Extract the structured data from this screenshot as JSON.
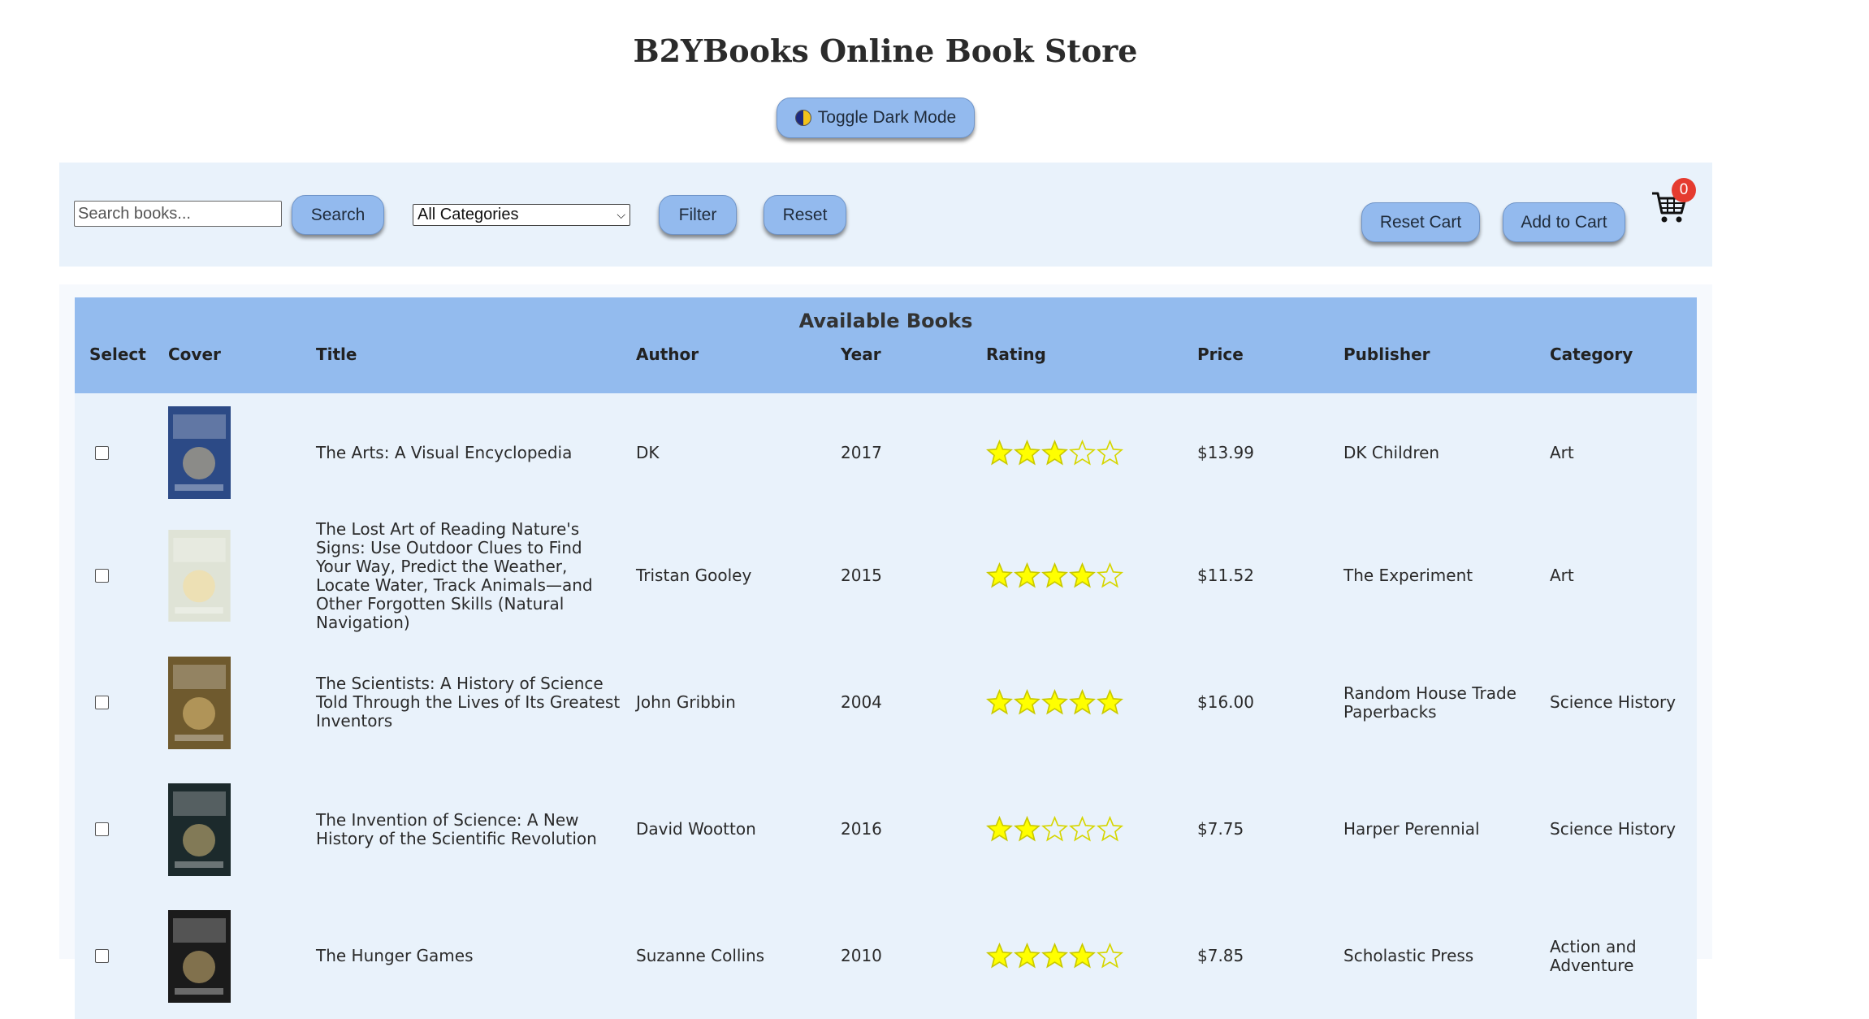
{
  "header": {
    "title": "B2YBooks Online Book Store",
    "toggle_label": "Toggle Dark Mode"
  },
  "toolbar": {
    "search_placeholder": "Search books...",
    "search_label": "Search",
    "category_selected": "All Categories",
    "filter_label": "Filter",
    "reset_label": "Reset",
    "reset_cart_label": "Reset Cart",
    "add_to_cart_label": "Add to Cart",
    "cart_count": "0"
  },
  "table": {
    "caption": "Available Books",
    "columns": [
      "Select",
      "Cover",
      "Title",
      "Author",
      "Year",
      "Rating",
      "Price",
      "Publisher",
      "Category"
    ],
    "rows": [
      {
        "title": "The Arts: A Visual Encyclopedia",
        "author": "DK",
        "year": "2017",
        "rating": 3,
        "price": "$13.99",
        "publisher": "DK Children",
        "category": "Art",
        "cover_color": "#2c4a86"
      },
      {
        "title": "The Lost Art of Reading Nature's Signs: Use Outdoor Clues to Find Your Way, Predict the Weather, Locate Water, Track Animals—and Other Forgotten Skills (Natural Navigation)",
        "author": "Tristan Gooley",
        "year": "2015",
        "rating": 4,
        "price": "$11.52",
        "publisher": "The Experiment",
        "category": "Art",
        "cover_color": "#dfe3d6"
      },
      {
        "title": "The Scientists: A History of Science Told Through the Lives of Its Greatest Inventors",
        "author": "John Gribbin",
        "year": "2004",
        "rating": 5,
        "price": "$16.00",
        "publisher": "Random House Trade Paperbacks",
        "category": "Science History",
        "cover_color": "#6f5a2e"
      },
      {
        "title": "The Invention of Science: A New History of the Scientific Revolution",
        "author": "David Wootton",
        "year": "2016",
        "rating": 2,
        "price": "$7.75",
        "publisher": "Harper Perennial",
        "category": "Science History",
        "cover_color": "#1c2a2c"
      },
      {
        "title": "The Hunger Games",
        "author": "Suzanne Collins",
        "year": "2010",
        "rating": 4,
        "price": "$7.85",
        "publisher": "Scholastic Press",
        "category": "Action and Adventure",
        "cover_color": "#1b1b1b"
      }
    ]
  }
}
